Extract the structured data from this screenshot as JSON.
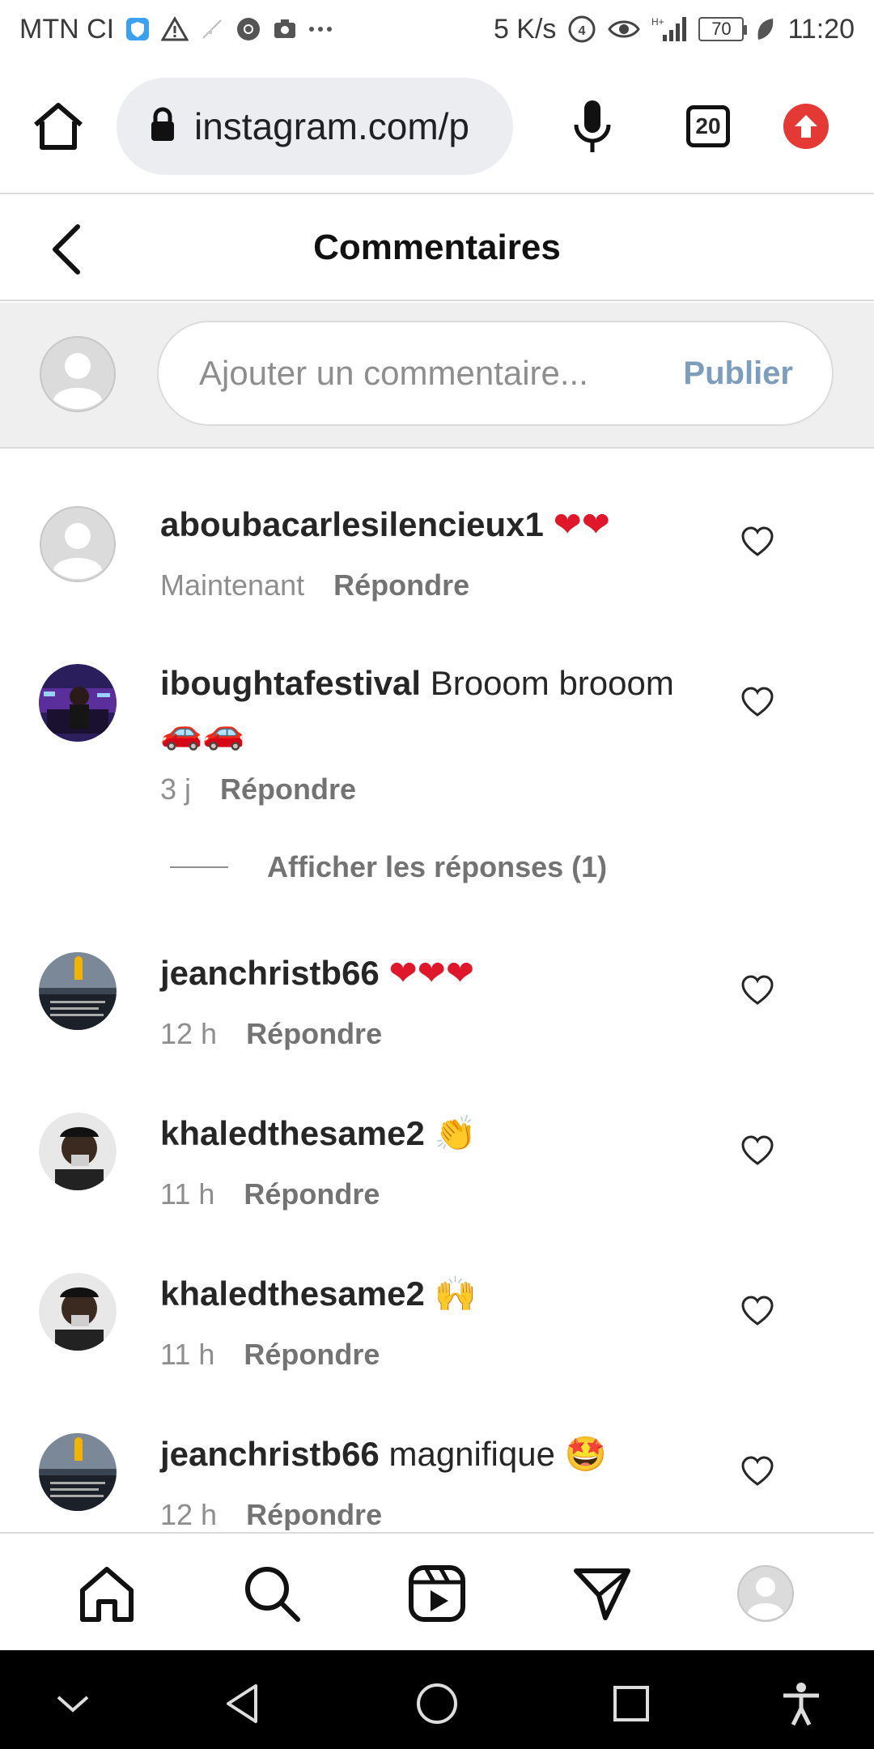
{
  "status_bar": {
    "carrier": "MTN CI",
    "speed": "5 K/s",
    "battery": "70",
    "time": "11:20"
  },
  "browser": {
    "url": "instagram.com/p",
    "tab_count": "20"
  },
  "header": {
    "title": "Commentaires"
  },
  "composer": {
    "placeholder": "Ajouter un commentaire...",
    "publish_label": "Publier"
  },
  "comments": [
    {
      "user": "aboubacarlesilencieux1",
      "text": "❤❤",
      "time": "Maintenant",
      "reply": "Répondre"
    },
    {
      "user": "iboughtafestival",
      "text": "Brooom brooom 🚗🚗",
      "time": "3 j",
      "reply": "Répondre"
    },
    {
      "user": "jeanchristb66",
      "text": "❤❤❤",
      "time": "12 h",
      "reply": "Répondre"
    },
    {
      "user": "khaledthesame2",
      "text": "👏",
      "time": "11 h",
      "reply": "Répondre"
    },
    {
      "user": "khaledthesame2",
      "text": "🙌",
      "time": "11 h",
      "reply": "Répondre"
    },
    {
      "user": "jeanchristb66",
      "text": "magnifique 🤩",
      "time": "12 h",
      "reply": "Répondre"
    }
  ],
  "view_replies": "Afficher les réponses (1)",
  "colors": {
    "accent_red": "#e53935",
    "publish_blue": "#7d9dbd",
    "heart_red": "#e0162b",
    "muted": "#8e8e8e"
  }
}
